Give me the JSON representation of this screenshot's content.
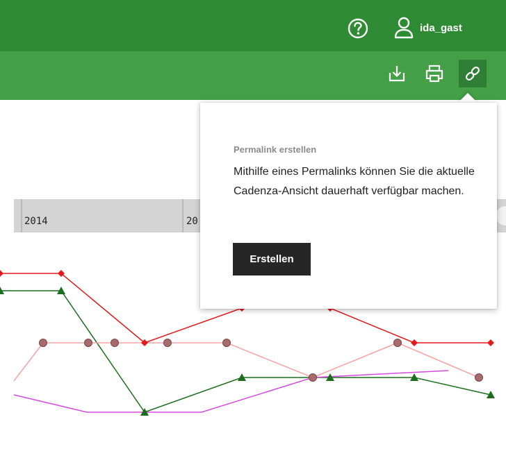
{
  "header": {
    "help_icon": "question-circle-icon",
    "user_icon": "user-icon",
    "username": "ida_gast"
  },
  "toolbar": {
    "download_icon": "download-icon",
    "print_icon": "printer-icon",
    "permalink_icon": "link-icon"
  },
  "timeline": {
    "labels": [
      "2014",
      "20"
    ]
  },
  "popover": {
    "title": "Permalink erstellen",
    "text": "Mithilfe eines Permalinks können Sie die aktuelle Cadenza-Ansicht dauerhaft verfügbar machen.",
    "button_label": "Erstellen"
  },
  "colors": {
    "header": "#2e8b34",
    "toolbar": "#43a047",
    "series_red": "#e31a1c",
    "series_green": "#1b6e1b",
    "series_pink": "#f4a6a6",
    "series_magenta": "#d54ae0"
  },
  "chart_data": {
    "type": "line",
    "series": [
      {
        "marker": "diamond",
        "color": "#e31a1c",
        "values": [
          null,
          3,
          null,
          1,
          2,
          2,
          1,
          1
        ]
      },
      {
        "marker": "triangle",
        "color": "#1b6e1b",
        "values": [
          null,
          2.5,
          null,
          -1,
          0,
          0,
          0,
          -0.5
        ]
      },
      {
        "marker": "circle",
        "color": "#f4a6a6",
        "values": [
          1,
          1,
          1,
          1,
          1,
          0,
          1,
          0
        ]
      },
      {
        "marker": "none",
        "color": "#d54ae0",
        "values": [
          -0.5,
          -1,
          -1,
          0,
          0,
          0.2
        ]
      }
    ]
  }
}
